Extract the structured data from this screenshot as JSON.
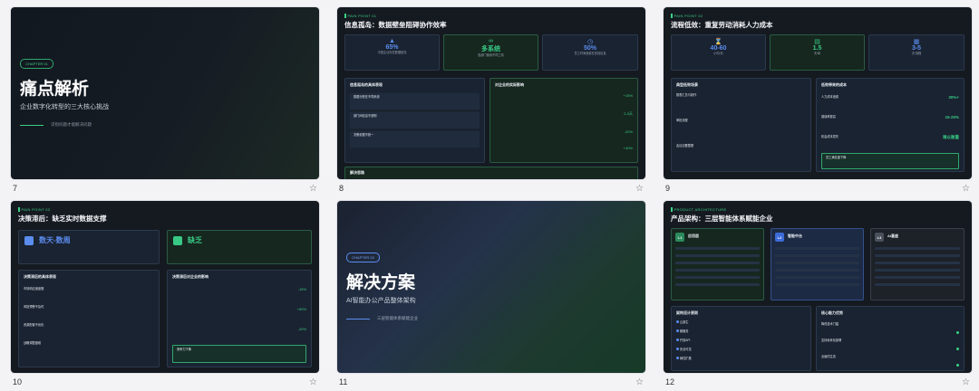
{
  "slides": [
    {
      "num": "7",
      "chapter": "CHAPTER 01",
      "title": "痛点解析",
      "subtitle": "企业数字化转型的三大核心挑战",
      "note": "识别问题才能解决问题"
    },
    {
      "num": "8",
      "tag": "PAIN POINT 01",
      "title": "信息孤岛：数据壁垒阻碍协作效率",
      "stats": [
        {
          "value": "65%",
          "desc": "中型企业存在数据孤岛"
        },
        {
          "value": "多系统",
          "desc": "各部门使用不同工具"
        },
        {
          "value": "50%",
          "desc": "员工时间浪费在查找信息"
        }
      ],
      "left_head": "信息孤岛的具体表现",
      "left_items": [
        "数据分散在不同系统",
        "部门间信息不透明",
        "决策依据不统一"
      ],
      "right_head": "对企业的实际影响",
      "right_values": [
        "+15%",
        "2-3天",
        "-20%",
        "+40%"
      ],
      "bottom_head": "解决思路"
    },
    {
      "num": "9",
      "tag": "PAIN POINT 02",
      "title": "流程低效：重复劳动消耗人力成本",
      "stats": [
        {
          "value": "40-60",
          "desc": "小时/月"
        },
        {
          "value": "1.5",
          "desc": "天/单"
        },
        {
          "value": "3-5",
          "desc": "次/流程"
        }
      ],
      "left_head": "典型低效场景",
      "left_items": [
        "报表汇总与制作",
        "审批流程",
        "会议纪要整理"
      ],
      "right_head": "低效带来的成本",
      "right_values": [
        "30%+",
        "15-20%",
        "难以衡量"
      ],
      "right_items": [
        "人力成本浪费",
        "错误率提高",
        "机会成本损失"
      ],
      "callout": "员工满意度下降"
    },
    {
      "num": "10",
      "tag": "PAIN POINT 03",
      "title": "决策滞后：缺乏实时数据支撑",
      "blue_value": "数天-数周",
      "green_value": "缺乏",
      "left_head": "决策滞后的具体表现",
      "left_items": [
        "市场响应速度慢",
        "风险预警不及时",
        "资源配置不优化",
        "战略调整困难"
      ],
      "right_head": "决策滞后对企业的影响",
      "right_values": [
        "-15%",
        "+60%",
        "-20%"
      ],
      "callout": "竞争力下降"
    },
    {
      "num": "11",
      "chapter": "CHAPTER 02",
      "title": "解决方案",
      "subtitle": "AI智能办公产品整体架构",
      "note": "三层智能体系赋能企业"
    },
    {
      "num": "12",
      "tag": "PRODUCT ARCHITECTURE",
      "title": "产品架构：三层智能体系赋能企业",
      "layers": [
        {
          "badge": "L1",
          "name": "应用层"
        },
        {
          "badge": "L2",
          "name": "智能中台"
        },
        {
          "badge": "L3",
          "name": "AI基座"
        }
      ],
      "bottom_left_head": "架构设计原则",
      "bottom_left_items": [
        "云原生",
        "微服务",
        "开放API",
        "安全可控",
        "弹性扩展"
      ],
      "bottom_right_head": "核心能力优势",
      "bottom_right_items": [
        "降低技术门槛",
        "支持私有化部署",
        "全面的生态"
      ]
    }
  ]
}
